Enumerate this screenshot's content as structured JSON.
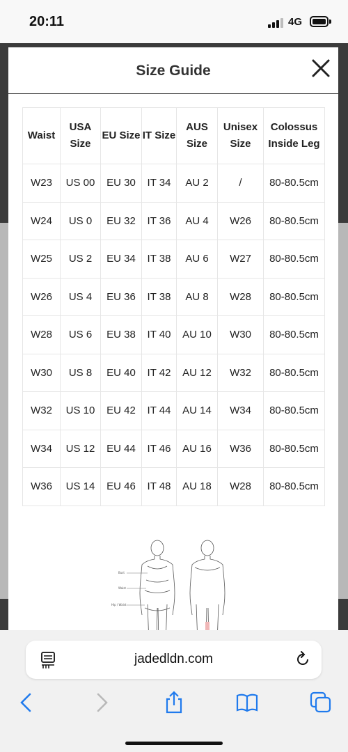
{
  "status_bar": {
    "time": "20:11",
    "network": "4G"
  },
  "modal": {
    "title": "Size Guide",
    "table": {
      "headers": [
        "Waist",
        "USA Size",
        "EU Size",
        "IT Size",
        "AUS Size",
        "Unisex Size",
        "Colossus Inside Leg"
      ],
      "rows": [
        [
          "W23",
          "US 00",
          "EU 30",
          "IT 34",
          "AU 2",
          "/",
          "80-80.5cm"
        ],
        [
          "W24",
          "US 0",
          "EU 32",
          "IT 36",
          "AU 4",
          "W26",
          "80-80.5cm"
        ],
        [
          "W25",
          "US 2",
          "EU 34",
          "IT 38",
          "AU 6",
          "W27",
          "80-80.5cm"
        ],
        [
          "W26",
          "US 4",
          "EU 36",
          "IT 38",
          "AU 8",
          "W28",
          "80-80.5cm"
        ],
        [
          "W28",
          "US 6",
          "EU 38",
          "IT 40",
          "AU 10",
          "W30",
          "80-80.5cm"
        ],
        [
          "W30",
          "US 8",
          "EU 40",
          "IT 42",
          "AU 12",
          "W32",
          "80-80.5cm"
        ],
        [
          "W32",
          "US 10",
          "EU 42",
          "IT 44",
          "AU 14",
          "W34",
          "80-80.5cm"
        ],
        [
          "W34",
          "US 12",
          "EU 44",
          "IT 46",
          "AU 16",
          "W36",
          "80-80.5cm"
        ],
        [
          "W36",
          "US 14",
          "EU 46",
          "IT 48",
          "AU 18",
          "W28",
          "80-80.5cm"
        ]
      ]
    },
    "figure_labels": [
      "Bust",
      "Waist",
      "Hip / Waist"
    ]
  },
  "browser": {
    "url": "jadedldn.com",
    "icons": {
      "reader": "reader-view-icon",
      "reload": "reload-icon",
      "back": "back-icon",
      "forward": "forward-icon",
      "share": "share-icon",
      "bookmarks": "bookmarks-icon",
      "tabs": "tabs-icon"
    }
  }
}
